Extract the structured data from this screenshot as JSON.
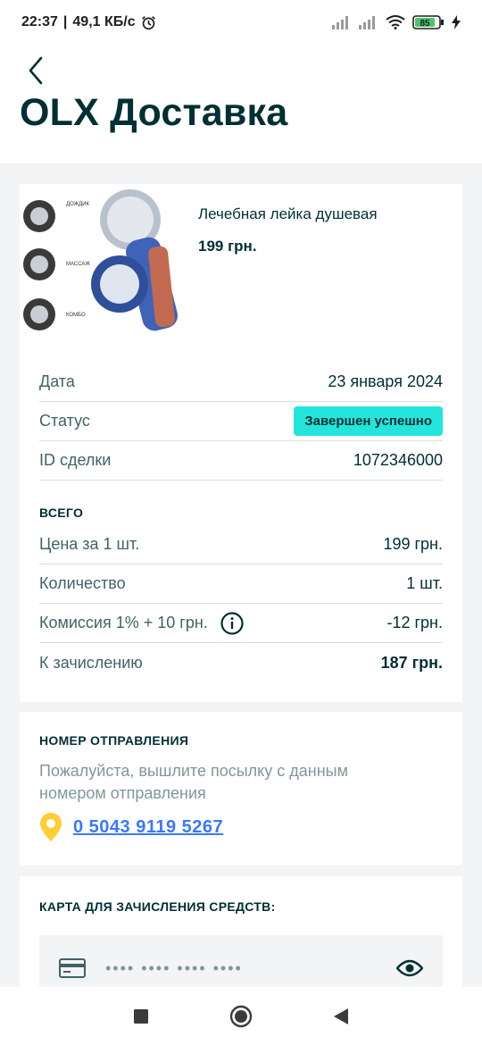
{
  "status_bar": {
    "time": "22:37",
    "network_speed": "49,1 КБ/с",
    "battery": "85"
  },
  "header": {
    "title": "OLX Доставка"
  },
  "product": {
    "name": "Лечебная лейка душевая",
    "price": "199 грн.",
    "image_labels": [
      "ДОЖДИК",
      "МАССАЖ",
      "КОМБО"
    ]
  },
  "details": {
    "date_label": "Дата",
    "date_value": "23 января 2024",
    "status_label": "Статус",
    "status_value": "Завершен успешно",
    "deal_label": "ID сделки",
    "deal_value": "1072346000"
  },
  "totals": {
    "heading": "ВСЕГО",
    "unit_price_label": "Цена за 1 шт.",
    "unit_price_value": "199 грн.",
    "qty_label": "Количество",
    "qty_value": "1 шт.",
    "fee_label": "Комиссия 1% + 10 грн.",
    "fee_value": "-12 грн.",
    "payout_label": "К зачислению",
    "payout_value": "187 грн."
  },
  "tracking": {
    "heading": "НОМЕР ОТПРАВЛЕНИЯ",
    "hint": "Пожалуйста, вышлите посылку с данным номером отправления",
    "number": "0 5043 9119 5267"
  },
  "payout_card": {
    "heading": "КАРТА ДЛЯ ЗАЧИСЛЕНИЯ СРЕДСТВ:",
    "masked_number": "•••• •••• •••• ••••"
  },
  "colors": {
    "accent_badge": "#23e5db",
    "link": "#3a77ff",
    "text_primary": "#002f34",
    "pin": "#ffce32"
  }
}
